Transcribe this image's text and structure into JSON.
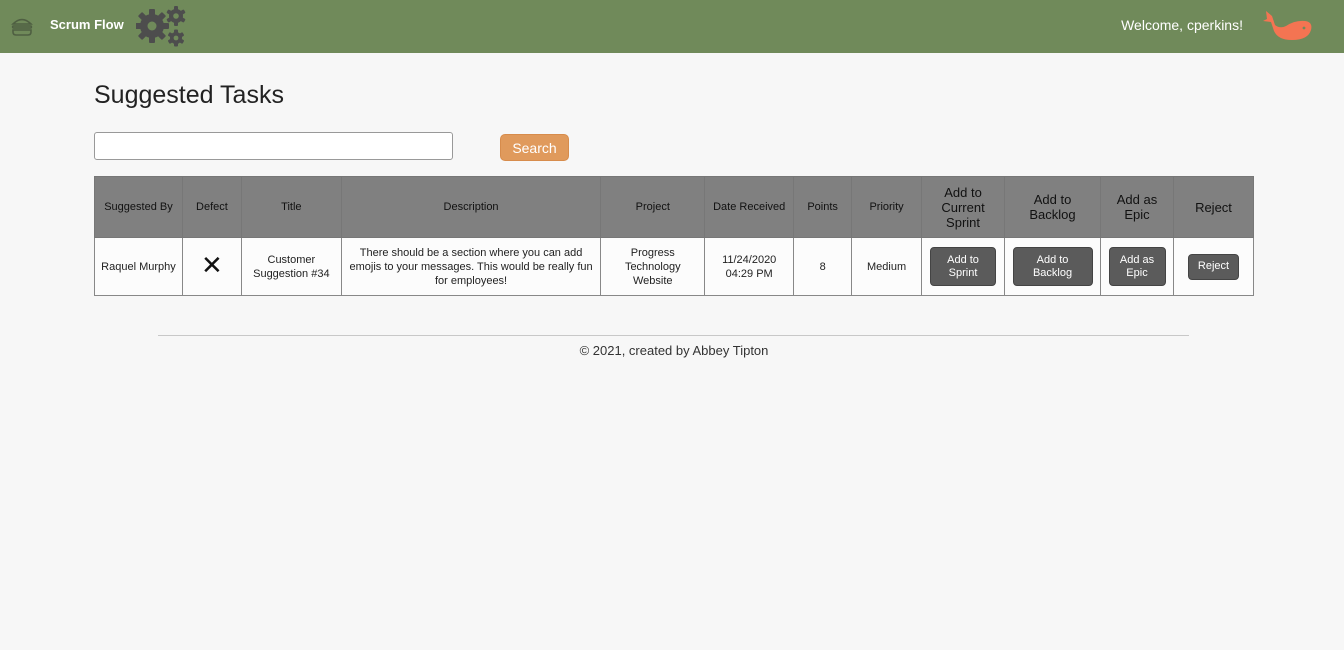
{
  "nav": {
    "brand": "Scrum Flow",
    "welcome": "Welcome, cperkins!",
    "bar_color": "#708a5a",
    "whale_color": "#f47452",
    "icons": [
      "hamburger-icon",
      "gears-icon",
      "whale-icon"
    ]
  },
  "page": {
    "title": "Suggested Tasks"
  },
  "search": {
    "value": "",
    "placeholder": "",
    "button_label": "Search",
    "button_color": "#e09a5c"
  },
  "table": {
    "headers": {
      "suggested_by": "Suggested By",
      "defect": "Defect",
      "title": "Title",
      "description": "Description",
      "project": "Project",
      "date_received": "Date Received",
      "points": "Points",
      "priority": "Priority",
      "add_current_sprint": "Add to Current Sprint",
      "add_backlog": "Add to Backlog",
      "add_epic": "Add as Epic",
      "reject": "Reject"
    },
    "rows": [
      {
        "suggested_by": "Raquel Murphy",
        "defect": "✕",
        "title": "Customer Suggestion #34",
        "description": "There should be a section where you can add emojis to your messages. This would be really fun for employees!",
        "project": "Progress Technology Website",
        "date_received": "11/24/2020 04:29 PM",
        "points": "8",
        "priority": "Medium",
        "actions": {
          "add_sprint": "Add to Sprint",
          "add_backlog": "Add to Backlog",
          "add_epic": "Add as Epic",
          "reject": "Reject"
        }
      }
    ]
  },
  "footer": {
    "text": "© 2021, created by Abbey Tipton"
  }
}
